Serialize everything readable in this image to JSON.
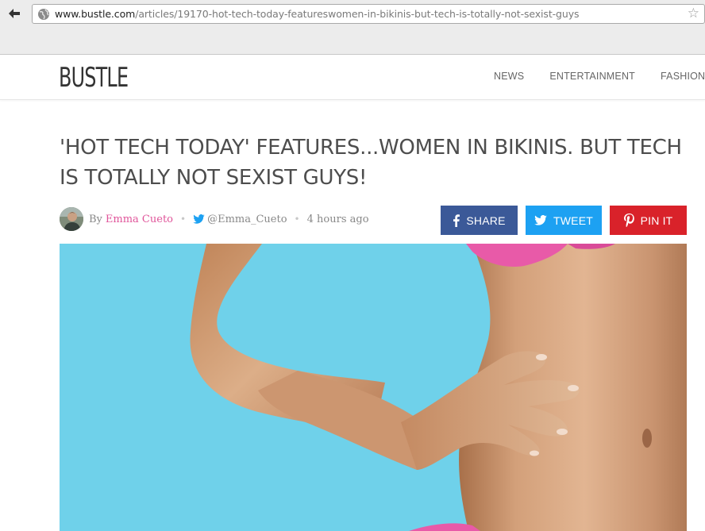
{
  "browser": {
    "url_domain": "www.bustle.com",
    "url_path": "/articles/19170-hot-tech-today-featureswomen-in-bikinis-but-tech-is-totally-not-sexist-guys"
  },
  "site": {
    "logo": "BUSTLE",
    "nav": [
      "NEWS",
      "ENTERTAINMENT",
      "FASHION & B"
    ]
  },
  "article": {
    "headline": "'HOT TECH TODAY' FEATURES...WOMEN IN BIKINIS. BUT TECH IS TOTALLY NOT SEXIST GUYS!",
    "by_label": "By",
    "author": "Emma Cueto",
    "twitter_handle": "@Emma_Cueto",
    "time": "4 hours ago"
  },
  "share": {
    "facebook_label": "SHARE",
    "twitter_label": "TWEET",
    "pinterest_label": "PIN IT"
  },
  "colors": {
    "author_pink": "#e0559a",
    "facebook": "#3b5998",
    "twitter": "#1da1f2",
    "pinterest": "#d9222a",
    "hero_sky": "#6fd1ea"
  },
  "icons": {
    "back": "back-arrow-icon",
    "site_identity": "globe-icon",
    "bookmark": "star-icon",
    "facebook": "facebook-icon",
    "twitter": "twitter-icon",
    "pinterest": "pinterest-icon"
  }
}
